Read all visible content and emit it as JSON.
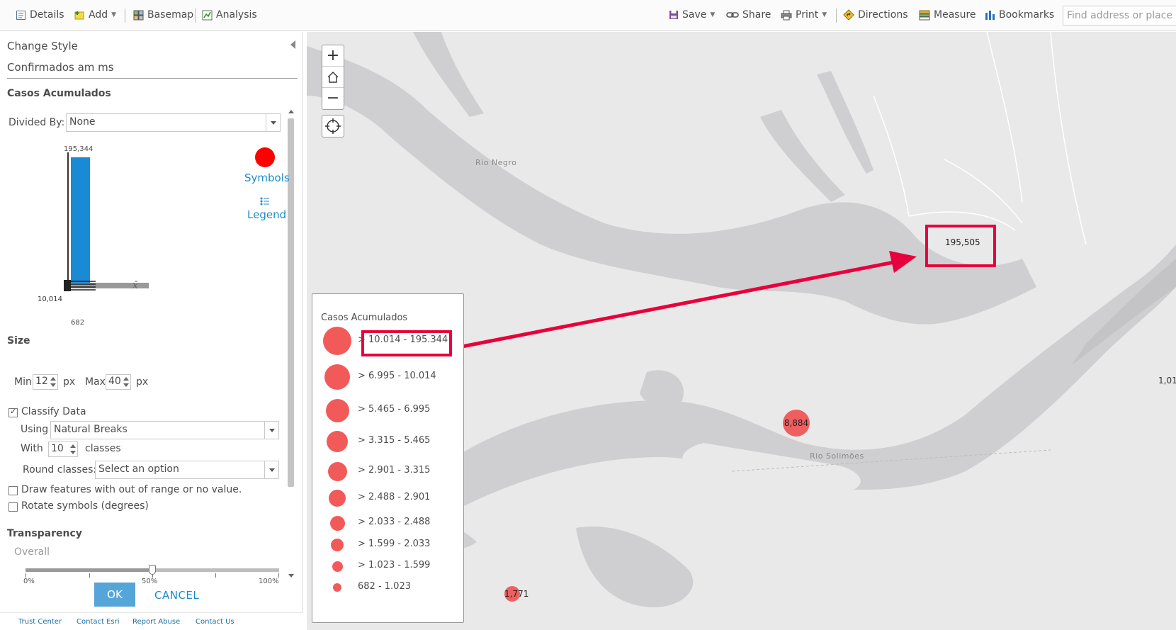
{
  "toolbar": {
    "details": "Details",
    "add": "Add",
    "basemap": "Basemap",
    "analysis": "Analysis",
    "save": "Save",
    "share": "Share",
    "print": "Print",
    "directions": "Directions",
    "measure": "Measure",
    "bookmarks": "Bookmarks",
    "search_placeholder": "Find address or place"
  },
  "panel": {
    "title": "Change Style",
    "layer_name": "Confirmados am ms",
    "field_name": "Casos Acumulados",
    "divided_by_label": "Divided By:",
    "divided_by_value": "None",
    "histogram": {
      "max": "195,344",
      "min_stack": "10,014",
      "min": "682",
      "mean_symbol": "x̄"
    },
    "symbols_link": "Symbols",
    "legend_link": "Legend",
    "size_header": "Size",
    "min_label": "Min",
    "min_value": "12",
    "min_unit": "px",
    "max_label": "Max",
    "max_value": "40",
    "max_unit": "px",
    "classify_label": "Classify Data",
    "using_label": "Using",
    "using_value": "Natural Breaks",
    "with_label": "With",
    "with_value": "10",
    "classes_label": "classes",
    "round_label": "Round classes:",
    "round_value": "Select an option",
    "draw_out_of_range": "Draw features with out of range or no value.",
    "rotate_symbols": "Rotate symbols (degrees)",
    "transparency_header": "Transparency",
    "overall_label": "Overall",
    "transparency_value": 0.5,
    "slider_labels": [
      "0%",
      "50%",
      "100%"
    ],
    "ok": "OK",
    "cancel": "CANCEL"
  },
  "footer": {
    "trust_center": "Trust Center",
    "contact_esri": "Contact Esri",
    "report_abuse": "Report Abuse",
    "contact_us": "Contact Us"
  },
  "map": {
    "labels": {
      "rio_negro": "Rio Negro",
      "rio_solimoes": "Rio Solimões"
    },
    "markers": {
      "manaus": "195,505",
      "mid": "8,884",
      "bottom": "1,771",
      "edge": "1,01"
    },
    "zoom_in": "+",
    "zoom_out": "−"
  },
  "legend": {
    "title": "Casos Acumulados",
    "items": [
      "> 10.014 - 195.344",
      "> 6.995 - 10.014",
      "> 5.465 - 6.995",
      "> 3.315 - 5.465",
      "> 2.901 - 3.315",
      "> 2.488 - 2.901",
      "> 2.033 - 2.488",
      "> 1.599 - 2.033",
      "> 1.023 - 1.599",
      "682 - 1.023"
    ]
  },
  "colors": {
    "symbol": "#ff0000",
    "legend_symbol": "#f25a5a",
    "annotation": "#e8003c",
    "link": "#1a8ac6",
    "ok_button": "#56a5d8"
  }
}
